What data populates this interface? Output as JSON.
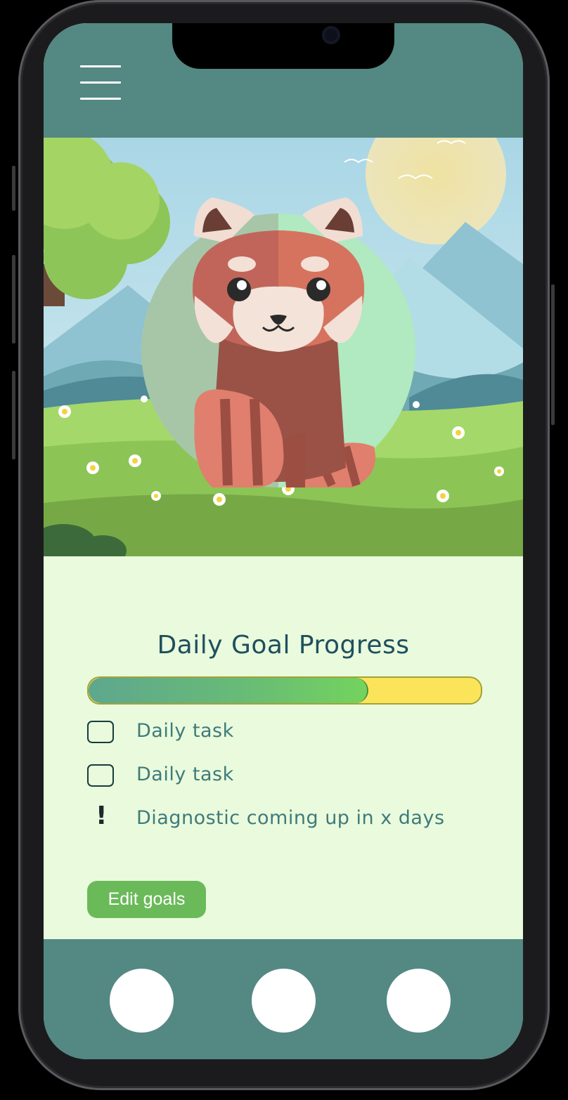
{
  "colors": {
    "topbar": "#548883",
    "content_bg": "#e9fbdc",
    "title": "#1f4f5f",
    "task_text": "#3f7a7c",
    "progress_track": "#fbe45a",
    "progress_fill_start": "#5ea78e",
    "progress_fill_end": "#74d35d",
    "edit_button": "#6bba5a"
  },
  "header": {
    "menu_icon": "hamburger-menu-icon"
  },
  "hero": {
    "illustration": "red-panda-in-meadow"
  },
  "goals": {
    "title": "Daily Goal Progress",
    "progress_fraction": 0.71,
    "tasks": [
      {
        "label": "Daily task",
        "icon": "checkbox-unchecked",
        "checked": false
      },
      {
        "label": "Daily task",
        "icon": "checkbox-unchecked",
        "checked": false
      }
    ],
    "notice": {
      "label": "Diagnostic coming up in x days",
      "icon": "exclamation-icon"
    },
    "edit_button_label": "Edit goals"
  },
  "bottom_nav": {
    "buttons": [
      "nav-button-1",
      "nav-button-2",
      "nav-button-3"
    ]
  }
}
